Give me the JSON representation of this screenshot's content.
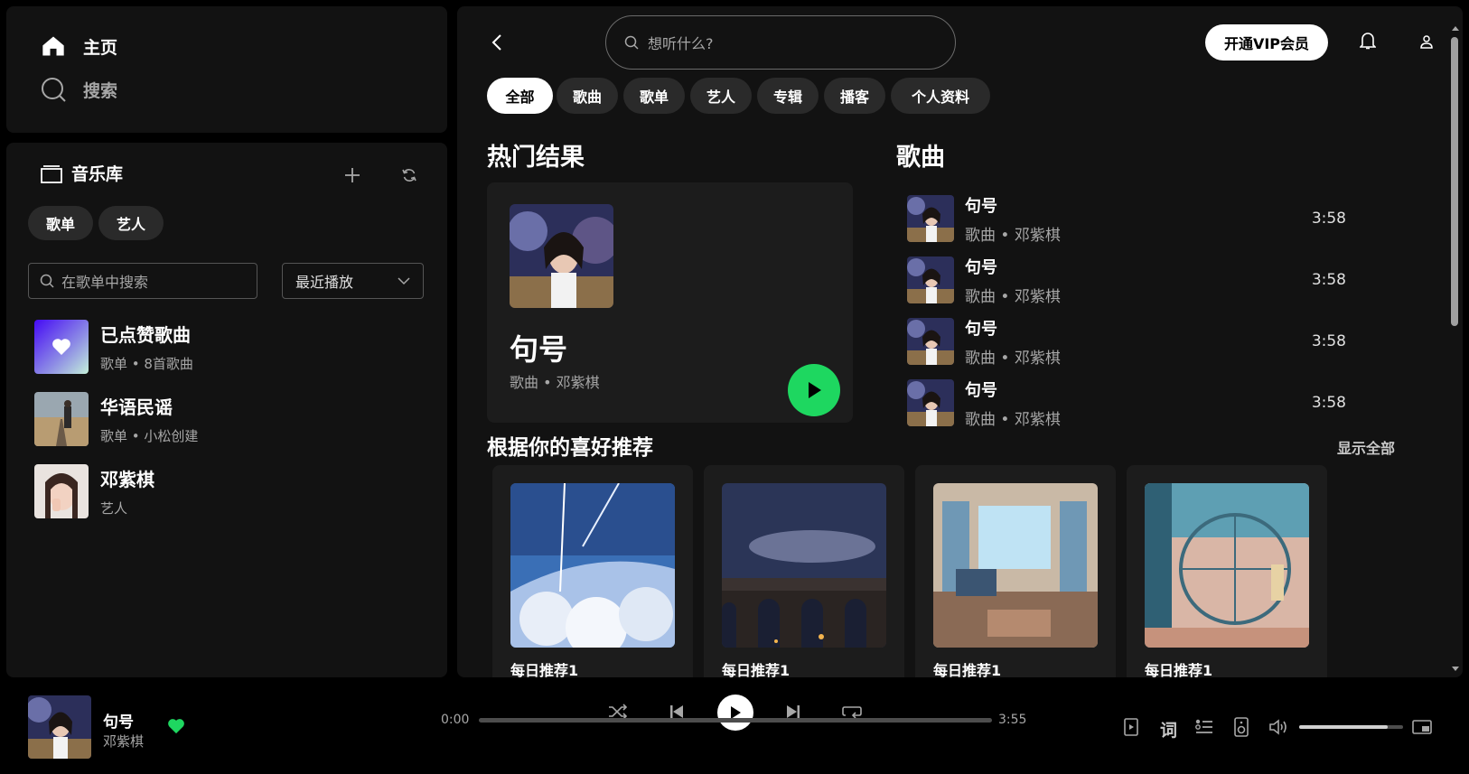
{
  "nav": {
    "home": "主页",
    "search": "搜索"
  },
  "library": {
    "title": "音乐库",
    "chips": [
      "歌单",
      "艺人"
    ],
    "search_placeholder": "在歌单中搜索",
    "sort_label": "最近播放",
    "items": [
      {
        "title": "已点赞歌曲",
        "subtitle": "歌单 • 8首歌曲"
      },
      {
        "title": "华语民谣",
        "subtitle": "歌单 • 小松创建"
      },
      {
        "title": "邓紫棋",
        "subtitle": "艺人"
      }
    ]
  },
  "header": {
    "search_placeholder": "想听什么?",
    "vip_button": "开通VIP会员"
  },
  "filters": [
    "全部",
    "歌曲",
    "歌单",
    "艺人",
    "专辑",
    "播客",
    "个人资料"
  ],
  "top_result": {
    "section_title": "热门结果",
    "title": "句号",
    "subtitle": "歌曲 • 邓紫棋"
  },
  "songs": {
    "section_title": "歌曲",
    "items": [
      {
        "title": "句号",
        "subtitle": "歌曲 • 邓紫棋",
        "duration": "3:58"
      },
      {
        "title": "句号",
        "subtitle": "歌曲 • 邓紫棋",
        "duration": "3:58"
      },
      {
        "title": "句号",
        "subtitle": "歌曲 • 邓紫棋",
        "duration": "3:58"
      },
      {
        "title": "句号",
        "subtitle": "歌曲 • 邓紫棋",
        "duration": "3:58"
      }
    ]
  },
  "recommendations": {
    "section_title": "根据你的喜好推荐",
    "show_all": "显示全部",
    "items": [
      {
        "label": "每日推荐1"
      },
      {
        "label": "每日推荐1"
      },
      {
        "label": "每日推荐1"
      },
      {
        "label": "每日推荐1"
      }
    ]
  },
  "player": {
    "title": "句号",
    "artist": "邓紫棋",
    "elapsed": "0:00",
    "total": "3:55",
    "progress": 0,
    "volume": 0.85,
    "lyrics_label": "词"
  },
  "colors": {
    "accent": "#1ed760",
    "liked_gradient_start": "#450af5",
    "liked_gradient_end": "#c4efd9"
  }
}
